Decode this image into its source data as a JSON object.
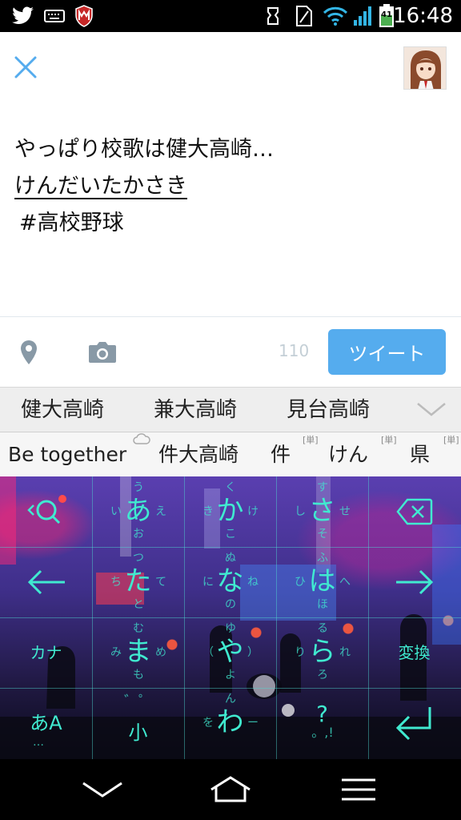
{
  "status_bar": {
    "time": "16:48",
    "battery_level": "41",
    "icons": [
      "twitter-icon",
      "keyboard-icon",
      "mcafee-icon",
      "alarm-icon",
      "sim-icon",
      "wifi-icon",
      "signal-icon",
      "battery-icon"
    ]
  },
  "compose": {
    "lines": [
      "やっぱり校歌は健大高崎…",
      "けんだいたかさき",
      "#高校野球"
    ]
  },
  "toolbar": {
    "char_count": "110",
    "tweet_label": "ツイート",
    "tweet_button_color": "#55acee"
  },
  "candidates": {
    "row1": [
      "健大高崎",
      "兼大高崎",
      "見台高崎"
    ],
    "row2": [
      "Be together",
      "件大高崎",
      "件",
      "けん",
      "県"
    ],
    "tag": "[単]"
  },
  "keyboard": {
    "accent_color": "#40ead0",
    "rows": [
      [
        {
          "name": "search",
          "main": ""
        },
        {
          "name": "a",
          "main": "あ",
          "up": "う",
          "left": "い",
          "right": "え",
          "down": "お"
        },
        {
          "name": "ka",
          "main": "か",
          "up": "く",
          "left": "き",
          "right": "け",
          "down": "こ"
        },
        {
          "name": "sa",
          "main": "さ",
          "up": "す",
          "left": "し",
          "right": "せ",
          "down": "そ"
        },
        {
          "name": "backspace",
          "main": ""
        }
      ],
      [
        {
          "name": "left",
          "main": ""
        },
        {
          "name": "ta",
          "main": "た",
          "up": "つ",
          "left": "ち",
          "right": "て",
          "down": "と"
        },
        {
          "name": "na",
          "main": "な",
          "up": "ぬ",
          "left": "に",
          "right": "ね",
          "down": "の"
        },
        {
          "name": "ha",
          "main": "は",
          "up": "ふ",
          "left": "ひ",
          "right": "へ",
          "down": "ほ"
        },
        {
          "name": "right",
          "main": ""
        }
      ],
      [
        {
          "name": "kana",
          "main": "カナ"
        },
        {
          "name": "ma",
          "main": "ま",
          "up": "む",
          "left": "み",
          "right": "め",
          "down": "も"
        },
        {
          "name": "ya",
          "main": "や",
          "up": "ゆ",
          "left": "（",
          "right": "）",
          "down": "よ"
        },
        {
          "name": "ra",
          "main": "ら",
          "up": "る",
          "left": "り",
          "right": "れ",
          "down": "ろ"
        },
        {
          "name": "convert",
          "main": "変換"
        }
      ],
      [
        {
          "name": "mode",
          "main": "あA",
          "down": "…"
        },
        {
          "name": "dakuten",
          "main": "小",
          "up": "゛゜"
        },
        {
          "name": "wa",
          "main": "わ",
          "up": "ん",
          "left": "を",
          "right": "ー"
        },
        {
          "name": "punct",
          "main": "?",
          "down": "。,!"
        },
        {
          "name": "enter",
          "main": ""
        }
      ]
    ]
  },
  "nav_bar": {
    "icons": [
      "back-icon",
      "home-icon",
      "menu-icon"
    ]
  }
}
